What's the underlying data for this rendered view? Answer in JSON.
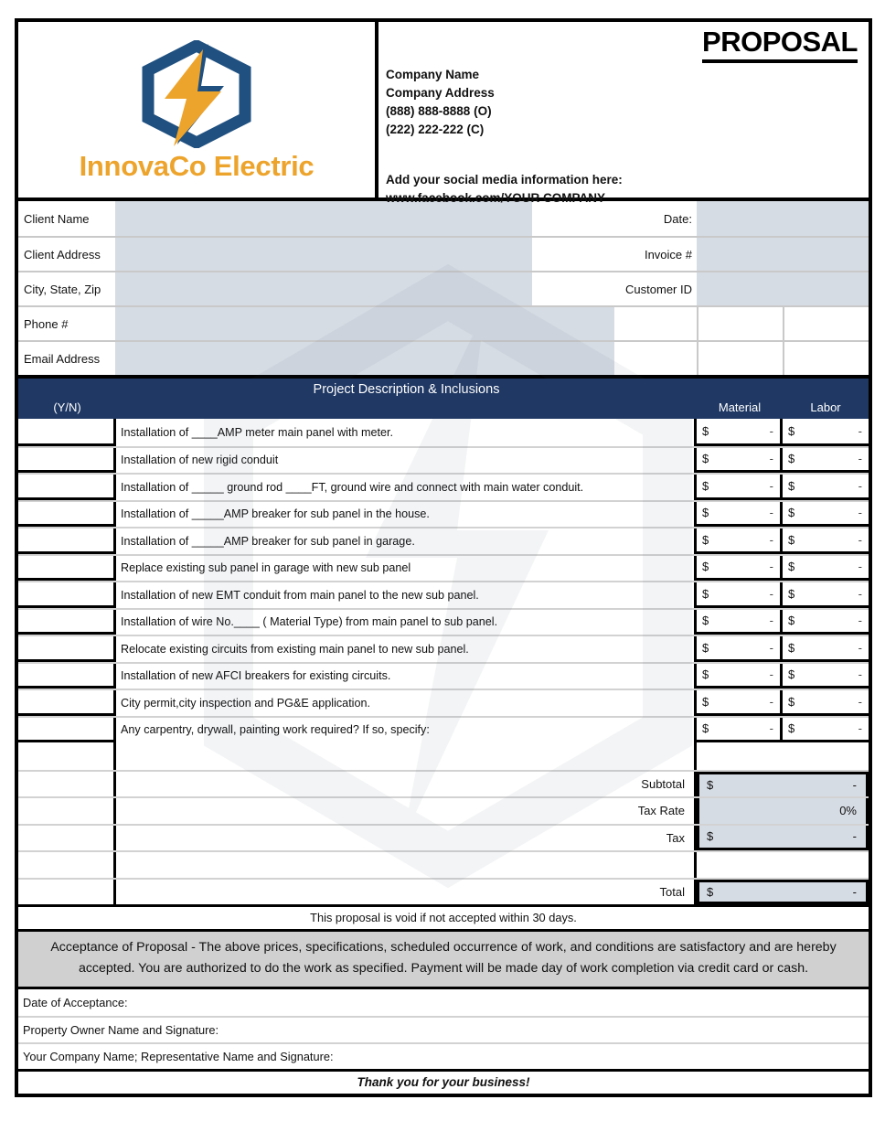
{
  "document": {
    "title": "PROPOSAL",
    "brand_name": "InnovaCo Electric",
    "logo_icon": "hexagon-lightning-bolt-icon",
    "colors": {
      "navy": "#1f3864",
      "logo_blue": "#1f5080",
      "logo_orange": "#eda42c",
      "field_fill": "#d6dce4",
      "acceptance_fill": "#d0d0d0"
    }
  },
  "company": {
    "name_line": "Company Name",
    "address_line": "Company Address",
    "phone_office": "(888) 888-8888 (O)",
    "phone_cell": "(222) 222-222 (C)",
    "social_prompt": "Add your social media information here:",
    "social_url": "www.facebook.com/YOUR COMPANY"
  },
  "client_fields": [
    {
      "label": "Client Name",
      "value": "",
      "right_label": "Date:",
      "right_value": ""
    },
    {
      "label": "Client Address",
      "value": "",
      "right_label": "Invoice #",
      "right_value": ""
    },
    {
      "label": "City, State, Zip",
      "value": "",
      "right_label": "Customer ID",
      "right_value": ""
    },
    {
      "label": "Phone #",
      "value": "",
      "right_label": "",
      "right_value": ""
    },
    {
      "label": "Email Address",
      "value": "",
      "right_label": "",
      "right_value": ""
    }
  ],
  "table": {
    "yn_header": "(Y/N)",
    "title": "Project Description & Inclusions",
    "material_header": "Material",
    "labor_header": "Labor",
    "currency_symbol": "$",
    "empty_amount": "-",
    "rows": [
      {
        "yn": "",
        "description": "Installation of ____AMP meter main panel with meter.",
        "material": "-",
        "labor": "-"
      },
      {
        "yn": "",
        "description": "Installation of new rigid conduit",
        "material": "-",
        "labor": "-"
      },
      {
        "yn": "",
        "description": "Installation of _____ ground rod ____FT, ground wire and connect with main water conduit.",
        "material": "-",
        "labor": "-"
      },
      {
        "yn": "",
        "description": "Installation of _____AMP breaker for sub panel in the house.",
        "material": "-",
        "labor": "-"
      },
      {
        "yn": "",
        "description": "Installation of _____AMP breaker for sub panel in garage.",
        "material": "-",
        "labor": "-"
      },
      {
        "yn": "",
        "description": "Replace existing sub panel in garage with new sub panel",
        "material": "-",
        "labor": "-"
      },
      {
        "yn": "",
        "description": "Installation of new EMT conduit from main panel to the new sub panel.",
        "material": "-",
        "labor": "-"
      },
      {
        "yn": "",
        "description": "Installation of wire No.____ ( Material Type) from main panel to sub panel.",
        "material": "-",
        "labor": "-"
      },
      {
        "yn": "",
        "description": "Relocate existing circuits from existing main panel to new sub panel.",
        "material": "-",
        "labor": "-"
      },
      {
        "yn": "",
        "description": "Installation of new AFCI breakers for existing circuits.",
        "material": "-",
        "labor": "-"
      },
      {
        "yn": "",
        "description": "City permit,city inspection and PG&E application.",
        "material": "-",
        "labor": "-"
      },
      {
        "yn": "",
        "description": "Any carpentry, drywall, painting work required? If so, specify:",
        "material": "-",
        "labor": "-"
      }
    ]
  },
  "totals": {
    "subtotal_label": "Subtotal",
    "subtotal_currency": "$",
    "subtotal_value": "-",
    "tax_rate_label": "Tax Rate",
    "tax_rate_value": "0%",
    "tax_label": "Tax",
    "tax_currency": "$",
    "tax_value": "-",
    "total_label": "Total",
    "total_currency": "$",
    "total_value": "-"
  },
  "footer": {
    "void_notice": "This proposal is void if not accepted within 30 days.",
    "acceptance_text": "Acceptance of Proposal  - The above prices, specifications, scheduled occurrence of work, and conditions are satisfactory and are hereby accepted. You are authorized to do the work as specified. Payment will be made day of work completion via credit card or cash.",
    "signature_rows": [
      "Date of Acceptance:",
      "Property Owner Name and Signature:",
      "Your Company Name; Representative Name and Signature:"
    ],
    "thank_you": "Thank you for your business!"
  }
}
